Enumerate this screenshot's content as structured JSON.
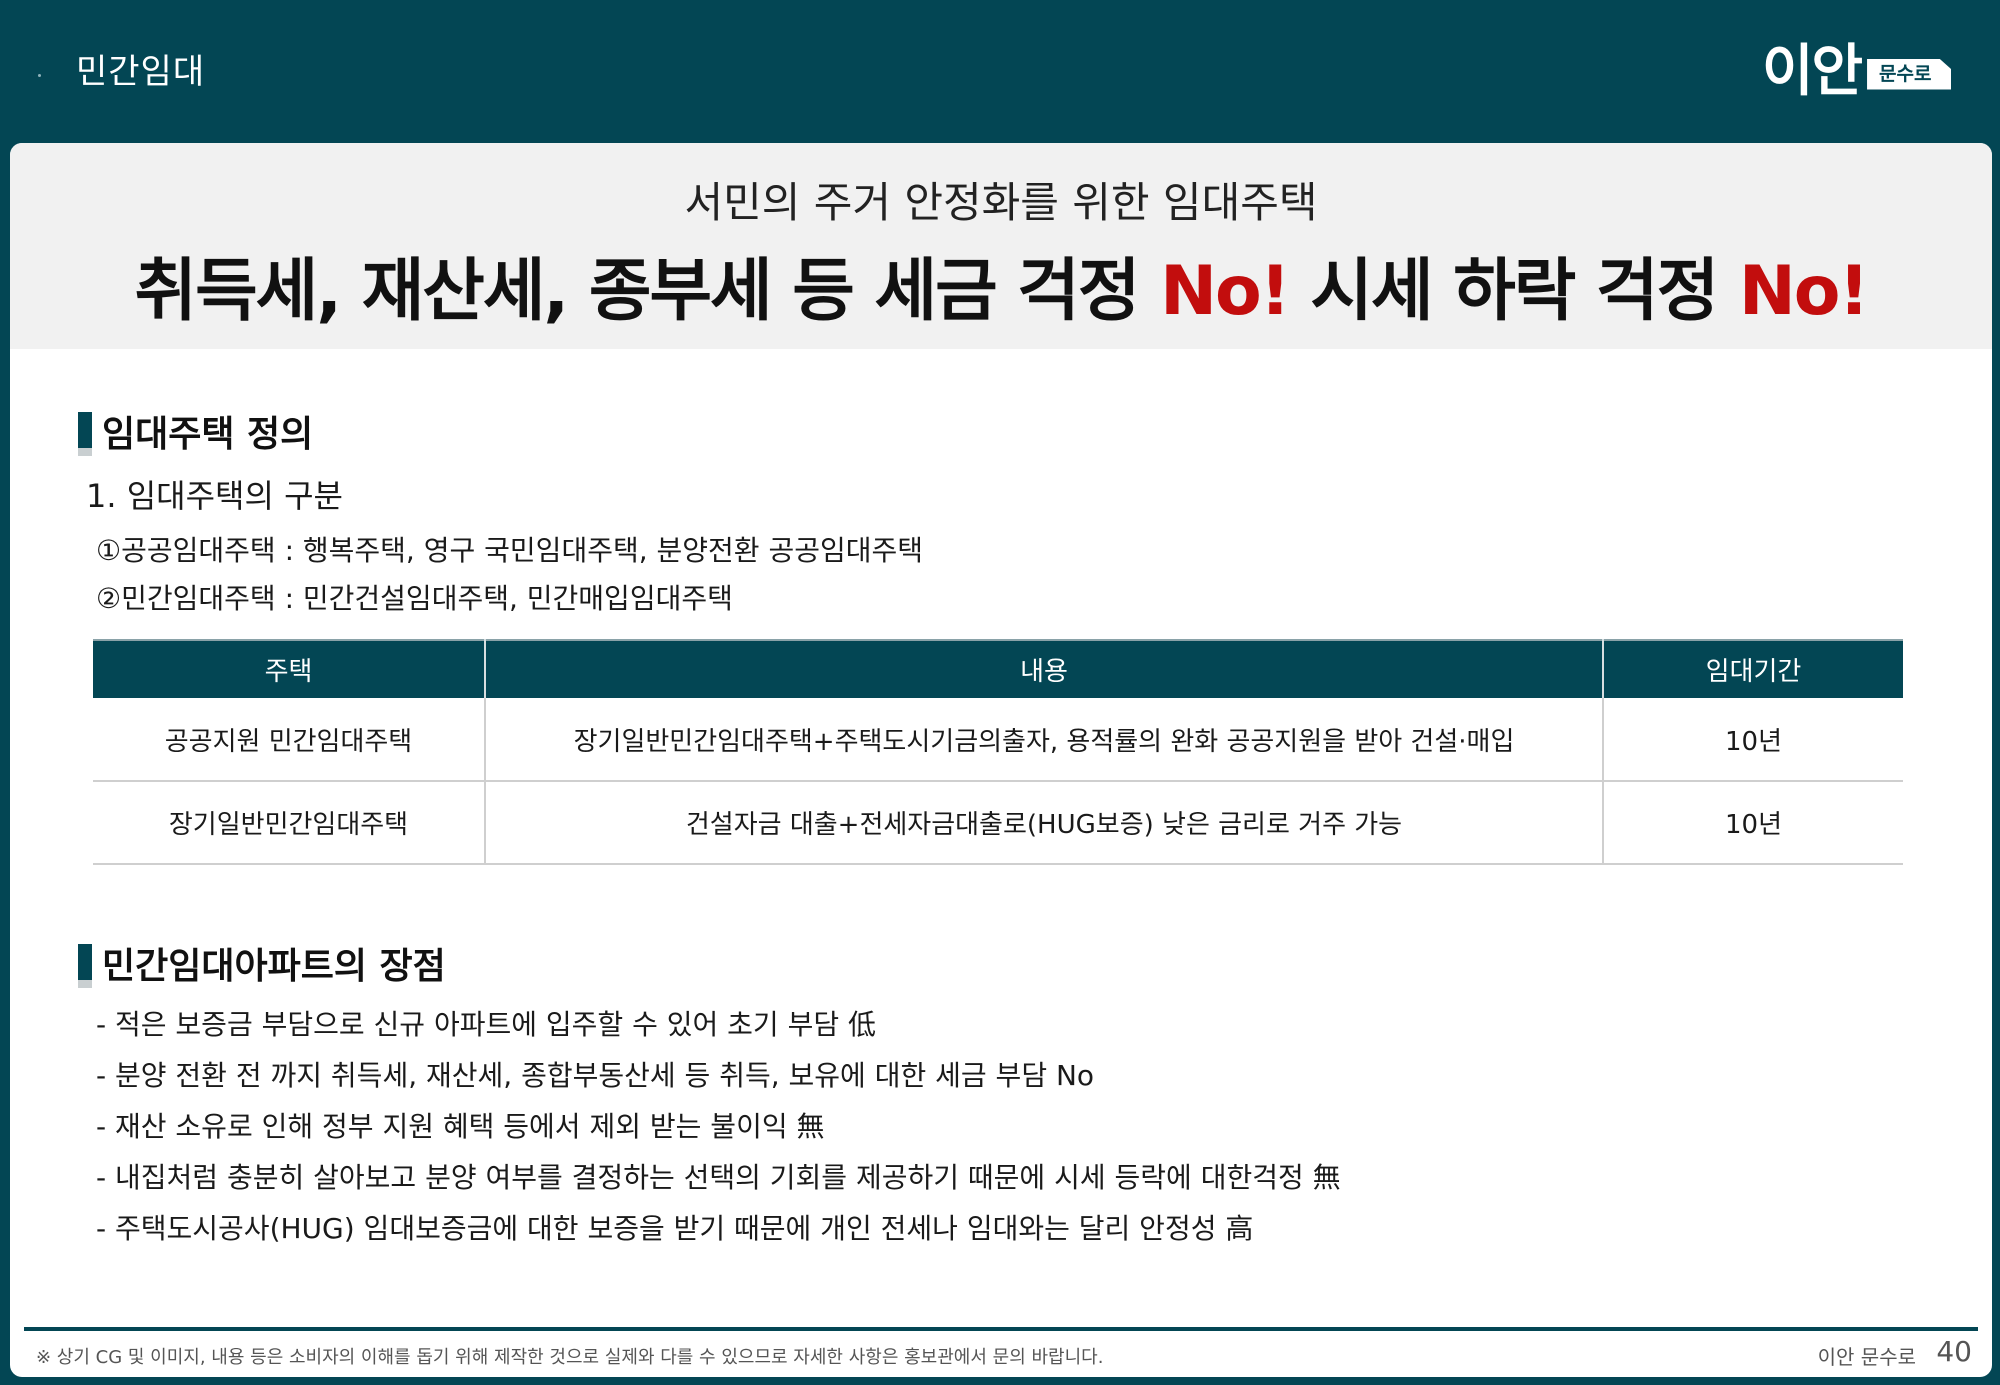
{
  "header": {
    "title": "민간임대",
    "brand_main": "이안",
    "brand_tag": "문수로"
  },
  "hero": {
    "subtitle": "서민의 주거 안정화를 위한 임대주택",
    "main_part1": "취득세, 재산세, 종부세 등 세금 걱정 ",
    "main_red1": "No!",
    "main_part2": " 시세 하락 걱정 ",
    "main_red2": "No!"
  },
  "section1": {
    "title": "임대주택 정의",
    "subhead": "1. 임대주택의 구분",
    "items": [
      "①공공임대주택 : 행복주택, 영구 국민임대주택, 분양전환 공공임대주택",
      "②민간임대주택 : 민간건설임대주택, 민간매입임대주택"
    ],
    "table": {
      "headers": [
        "주택",
        "내용",
        "임대기간"
      ],
      "rows": [
        [
          "공공지원 민간임대주택",
          "장기일반민간임대주택+주택도시기금의출자, 용적률의 완화 공공지원을 받아 건설·매입",
          "10년"
        ],
        [
          "장기일반민간임대주택",
          "건설자금 대출+전세자금대출로(HUG보증) 낮은 금리로 거주 가능",
          "10년"
        ]
      ]
    }
  },
  "section2": {
    "title": "민간임대아파트의 장점",
    "items": [
      "- 적은 보증금 부담으로 신규 아파트에 입주할 수 있어 초기 부담 低",
      "- 분양 전환 전 까지 취득세, 재산세, 종합부동산세 등 취득, 보유에 대한 세금 부담 No",
      "- 재산 소유로 인해 정부 지원 혜택 등에서 제외 받는 불이익 無",
      "- 내집처럼 충분히 살아보고 분양 여부를 결정하는 선택의 기회를 제공하기 때문에 시세 등락에 대한걱정 無",
      "- 주택도시공사(HUG) 임대보증금에 대한 보증을 받기 때문에 개인 전세나 임대와는 달리 안정성 高"
    ]
  },
  "footer": {
    "note": "※ 상기 CG 및 이미지, 내용 등은 소비자의 이해를 돕기 위해 제작한 것으로 실제와 다를 수 있으므로 자세한 사항은 홍보관에서 문의 바랍니다.",
    "brand": "이안 문수로",
    "page": "40"
  },
  "colors": {
    "brand_teal": "#034654",
    "accent_red": "#c20d0d",
    "hero_bg": "#f1f1f1"
  }
}
